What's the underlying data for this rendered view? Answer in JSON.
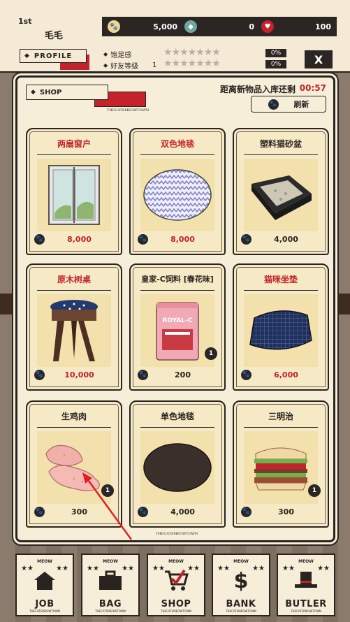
{
  "header": {
    "rank": "1st",
    "player_name": "毛毛",
    "profile_label": "PROFILE",
    "coins": "5,000",
    "gems": "0",
    "hearts": "100",
    "satisfaction_label": "饱足感",
    "satisfaction_pct": "0%",
    "friend_label": "好友等级",
    "friend_level": "1",
    "friend_pct": "0%",
    "close_label": "X"
  },
  "shop": {
    "title": "SHOP",
    "brand": "THECATSMEOWTOWN",
    "restock_label": "距离新物品入库还剩",
    "restock_timer": "00:57",
    "refresh_label": "刷新",
    "items": [
      {
        "name": "两扇窗户",
        "price": "8,000",
        "name_color": "red",
        "price_color": "red",
        "badge": ""
      },
      {
        "name": "双色地毯",
        "price": "8,000",
        "name_color": "red",
        "price_color": "red",
        "badge": ""
      },
      {
        "name": "塑料猫砂盆",
        "price": "4,000",
        "name_color": "dark",
        "price_color": "dark",
        "badge": ""
      },
      {
        "name": "原木树桌",
        "price": "10,000",
        "name_color": "red",
        "price_color": "red",
        "badge": ""
      },
      {
        "name": "皇家-C饲料 [春花味]",
        "price": "200",
        "name_color": "dark",
        "price_color": "dark",
        "badge": "1"
      },
      {
        "name": "猫咪坐垫",
        "price": "6,000",
        "name_color": "red",
        "price_color": "red",
        "badge": ""
      },
      {
        "name": "生鸡肉",
        "price": "300",
        "name_color": "dark",
        "price_color": "dark",
        "badge": "1"
      },
      {
        "name": "单色地毯",
        "price": "4,000",
        "name_color": "dark",
        "price_color": "dark",
        "badge": ""
      },
      {
        "name": "三明治",
        "price": "300",
        "name_color": "dark",
        "price_color": "dark",
        "badge": "1"
      }
    ]
  },
  "food_bag_label": "ROYAL-C",
  "nav": {
    "meow": "MEOW",
    "brand": "THECATSMEOWTOWN",
    "tabs": [
      {
        "label": "JOB",
        "icon": "house-icon"
      },
      {
        "label": "BAG",
        "icon": "briefcase-icon"
      },
      {
        "label": "SHOP",
        "icon": "shopping-cart-icon"
      },
      {
        "label": "BANK",
        "icon": "dollar-icon"
      },
      {
        "label": "BUTLER",
        "icon": "top-hat-icon"
      }
    ]
  },
  "colors": {
    "accent_red": "#c4232b",
    "dark": "#2b2624",
    "card_bg": "#f6e9c6"
  }
}
